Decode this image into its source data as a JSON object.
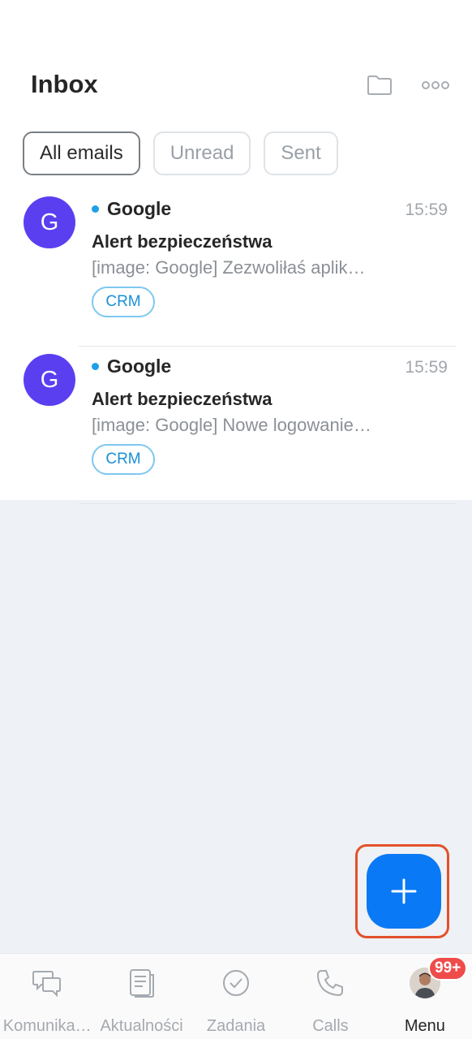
{
  "header": {
    "title": "Inbox",
    "icons": [
      "folder-icon",
      "more-icon"
    ]
  },
  "tabs": [
    {
      "label": "All emails",
      "active": true
    },
    {
      "label": "Unread",
      "active": false
    },
    {
      "label": "Sent",
      "active": false
    }
  ],
  "emails": [
    {
      "avatar_letter": "G",
      "sender": "Google",
      "time": "15:59",
      "subject": "Alert bezpieczeństwa",
      "preview": "[image: Google] Zezwoliłaś aplik…",
      "tag": "CRM",
      "unread": true
    },
    {
      "avatar_letter": "G",
      "sender": "Google",
      "time": "15:59",
      "subject": "Alert bezpieczeństwa",
      "preview": "[image: Google] Nowe logowanie…",
      "tag": "CRM",
      "unread": true
    }
  ],
  "fab": {
    "icon": "plus-icon"
  },
  "bottom_nav": [
    {
      "label": "Komunika…",
      "icon": "chat-icon"
    },
    {
      "label": "Aktualności",
      "icon": "news-icon"
    },
    {
      "label": "Zadania",
      "icon": "check-circle-icon"
    },
    {
      "label": "Calls",
      "icon": "phone-icon"
    },
    {
      "label": "Menu",
      "icon": "profile-avatar",
      "active": true,
      "badge": "99+"
    }
  ],
  "colors": {
    "accent": "#0a79f5",
    "avatar": "#5a3ff1",
    "unread_dot": "#1ea0e8",
    "badge": "#ef4b4b",
    "highlight_frame": "#e2512b"
  }
}
